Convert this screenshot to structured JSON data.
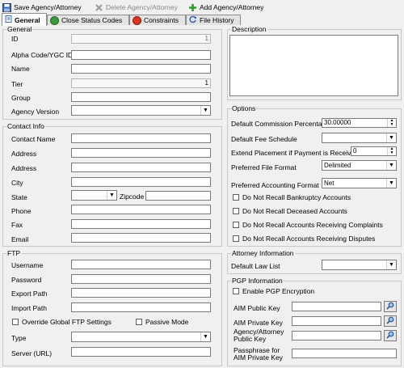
{
  "toolbar": {
    "save_label": "Save Agency/Attorney",
    "delete_label": "Delete Agency/Attorney",
    "add_label": "Add Agency/Attorney"
  },
  "tabs": [
    {
      "label": "General",
      "icon": "doc-icon"
    },
    {
      "label": "Close Status Codes",
      "icon": "globe-icon"
    },
    {
      "label": "Constraints",
      "icon": "stop-icon"
    },
    {
      "label": "File History",
      "icon": "refresh-icon"
    }
  ],
  "general": {
    "title": "General",
    "id_label": "ID",
    "id_value": "1",
    "alpha_label": "Alpha Code/YGC ID",
    "alpha_value": "",
    "name_label": "Name",
    "name_value": "",
    "tier_label": "Tier",
    "tier_value": "1",
    "group_label": "Group",
    "group_value": "",
    "version_label": "Agency Version",
    "version_value": ""
  },
  "contact": {
    "title": "Contact Info",
    "contact_name_label": "Contact Name",
    "address1_label": "Address",
    "address2_label": "Address",
    "city_label": "City",
    "state_label": "State",
    "zip_label": "Zipcode",
    "phone_label": "Phone",
    "fax_label": "Fax",
    "email_label": "Email"
  },
  "ftp": {
    "title": "FTP",
    "username_label": "Username",
    "password_label": "Password",
    "export_label": "Export Path",
    "import_label": "Import Path",
    "override_label": "Override Global FTP Settings",
    "passive_label": "Passive Mode",
    "type_label": "Type",
    "server_label": "Server (URL)"
  },
  "description": {
    "title": "Description",
    "value": ""
  },
  "options": {
    "title": "Options",
    "commission_label": "Default Commission Percentage",
    "commission_value": "30.00000",
    "fee_label": "Default Fee Schedule",
    "fee_value": "",
    "extend_label": "Extend Placement if Payment is Received",
    "extend_value": "0",
    "file_format_label": "Preferred File Format",
    "file_format_value": "Delimited",
    "accounting_label": "Preferred Accounting Format",
    "accounting_value": "Net",
    "chk_bankruptcy": "Do Not Recall Bankruptcy Accounts",
    "chk_deceased": "Do Not Recall Deceased Accounts",
    "chk_complaints": "Do Not Recall Accounts Receiving Complaints",
    "chk_disputes": "Do Not Recall Accounts Receiving Disputes"
  },
  "attorney": {
    "title": "Attorney Information",
    "law_list_label": "Default Law List",
    "law_list_value": ""
  },
  "pgp": {
    "title": "PGP Information",
    "enable_label": "Enable PGP Encryption",
    "public_key_label": "AIM Public Key",
    "private_key_label": "AIM Private Key",
    "agency_key_label_1": "Agency/Attorney",
    "agency_key_label_2": "Public Key",
    "passphrase_label_1": "Passphrase for",
    "passphrase_label_2": "AIM Private Key"
  },
  "colors": {
    "accent_tab": "#ffffff",
    "border": "#7a7a7a",
    "background": "#f0f0f0"
  }
}
